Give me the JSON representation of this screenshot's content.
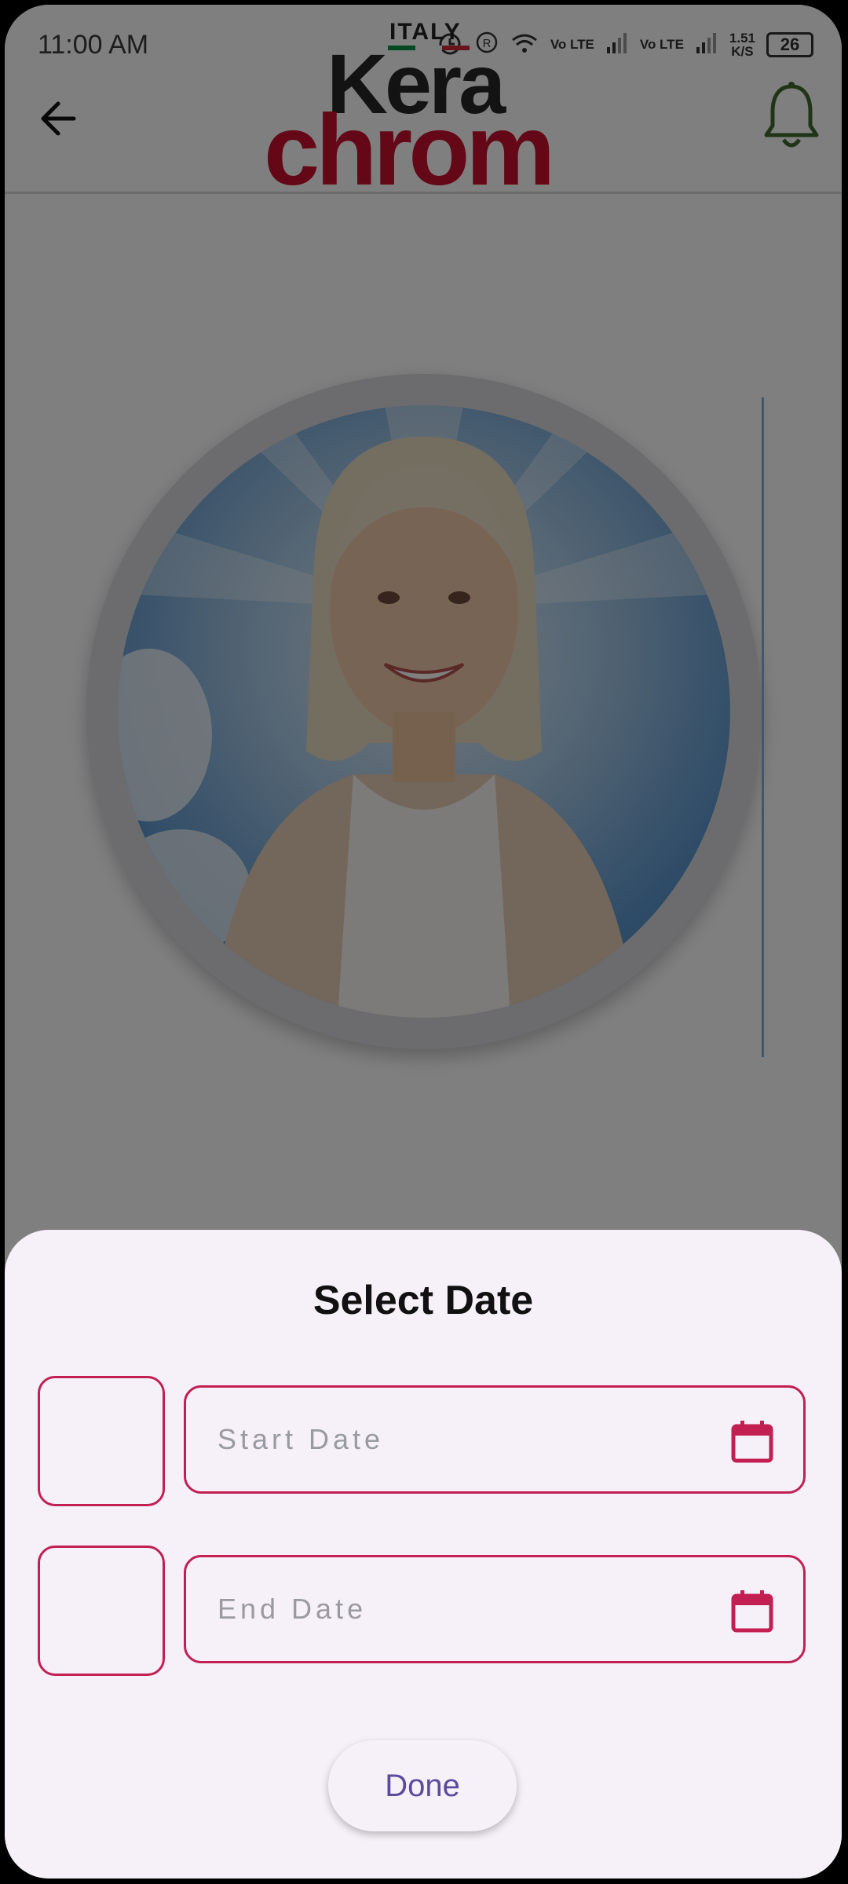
{
  "status_bar": {
    "time": "11:00 AM",
    "indicators": [
      "Vo LTE",
      "Vo LTE"
    ],
    "speed_value": "1.51",
    "speed_unit": "K/S",
    "battery": "26"
  },
  "header": {
    "logo": {
      "italy": "ITALY",
      "line1": "Kera",
      "line2": "chrom"
    },
    "back_icon": "arrow-left-icon",
    "notification_icon": "bell-icon"
  },
  "colors": {
    "accent": "#c21f52",
    "brand_red": "#c8102e",
    "sheet_bg": "#f6f1f8",
    "button_text": "#5d4a9c"
  },
  "sheet": {
    "title": "Select Date",
    "start_placeholder": "Start Date",
    "end_placeholder": "End Date",
    "done_label": "Done",
    "calendar_icon": "calendar-icon"
  }
}
